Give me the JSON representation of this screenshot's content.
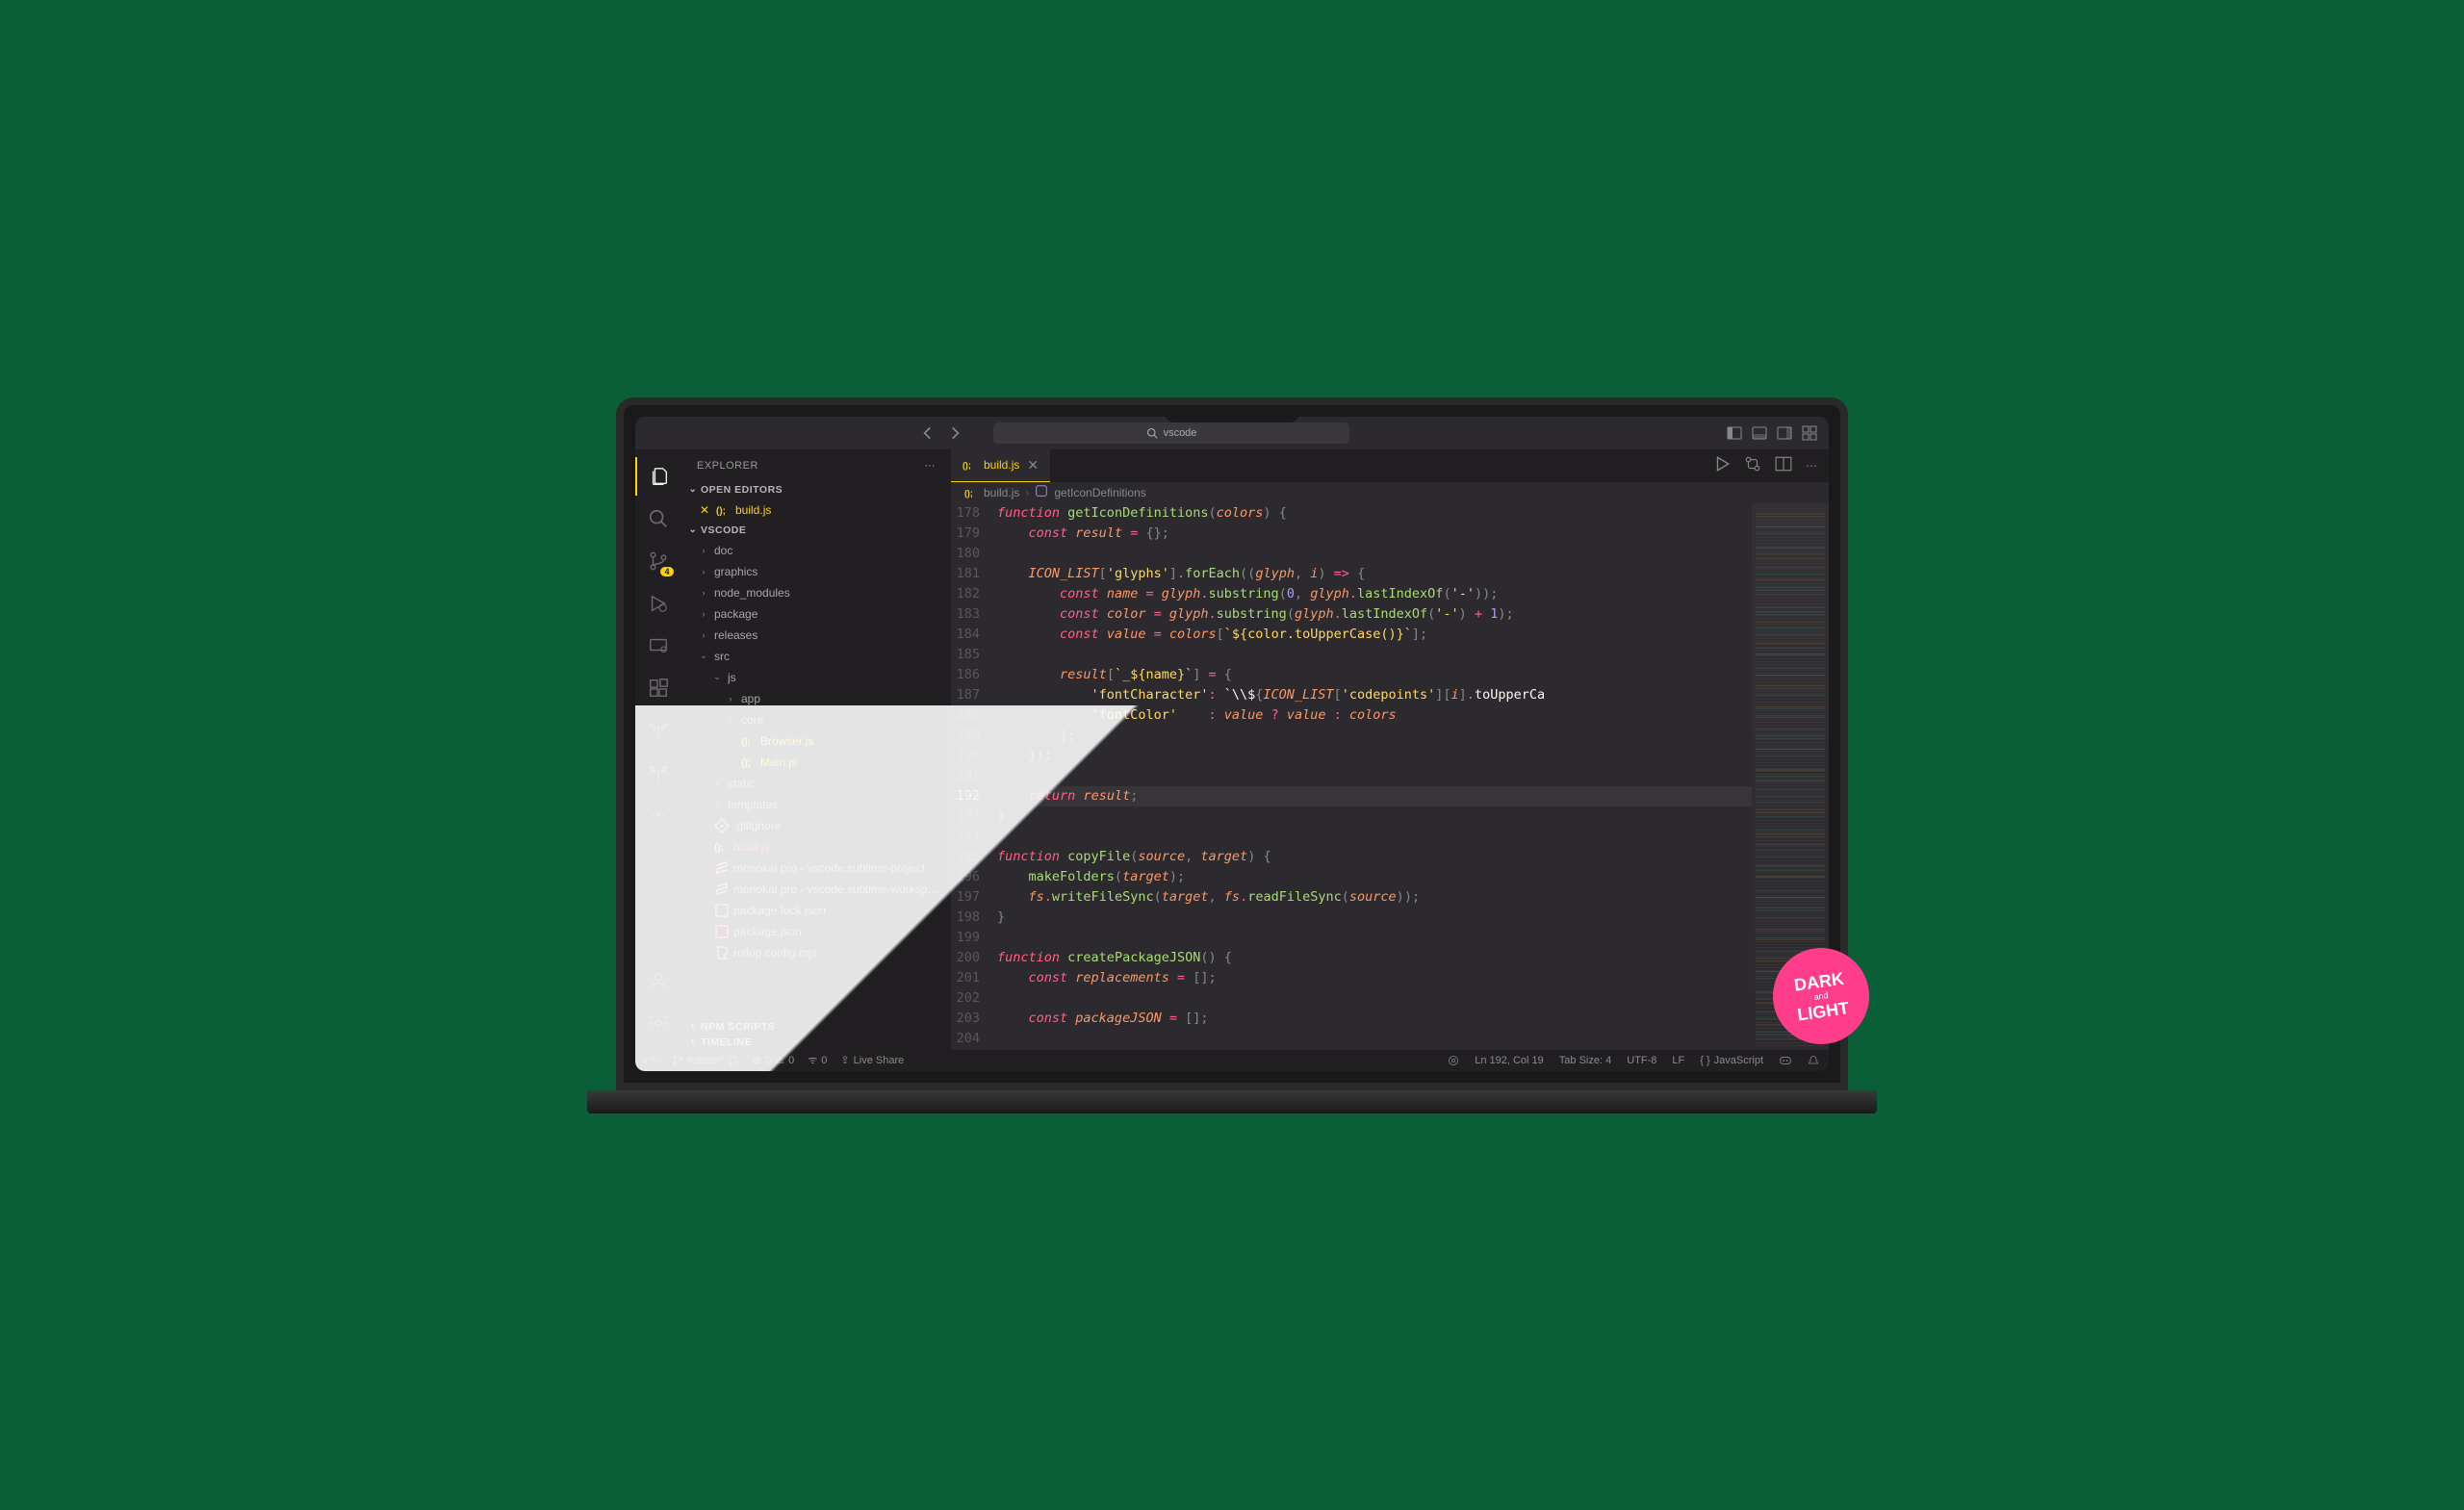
{
  "titlebar": {
    "search_placeholder": "vscode"
  },
  "sidebar": {
    "title": "EXPLORER",
    "sections": {
      "open_editors": {
        "label": "OPEN EDITORS",
        "items": [
          {
            "label": "build.js",
            "modified": true
          }
        ]
      },
      "project": {
        "label": "VSCODE",
        "tree": [
          {
            "label": "doc",
            "type": "folder",
            "depth": 0,
            "expanded": false
          },
          {
            "label": "graphics",
            "type": "folder",
            "depth": 0,
            "expanded": false
          },
          {
            "label": "node_modules",
            "type": "folder",
            "depth": 0,
            "expanded": false
          },
          {
            "label": "package",
            "type": "folder",
            "depth": 0,
            "expanded": false
          },
          {
            "label": "releases",
            "type": "folder",
            "depth": 0,
            "expanded": false
          },
          {
            "label": "src",
            "type": "folder",
            "depth": 0,
            "expanded": true
          },
          {
            "label": "js",
            "type": "folder",
            "depth": 1,
            "expanded": true
          },
          {
            "label": "app",
            "type": "folder",
            "depth": 2,
            "expanded": false
          },
          {
            "label": "core",
            "type": "folder",
            "depth": 2,
            "expanded": false
          },
          {
            "label": "Browser.js",
            "type": "js",
            "depth": 2,
            "modified": true
          },
          {
            "label": "Main.js",
            "type": "js",
            "depth": 2,
            "modified": true
          },
          {
            "label": "static",
            "type": "folder",
            "depth": 1,
            "expanded": false
          },
          {
            "label": "templates",
            "type": "folder",
            "depth": 1,
            "expanded": false
          },
          {
            "label": ".gitignore",
            "type": "git",
            "depth": 0
          },
          {
            "label": "build.js",
            "type": "js",
            "depth": 0,
            "current": true
          },
          {
            "label": "monokai pro - vscode.sublime-project",
            "type": "sublime",
            "depth": 0
          },
          {
            "label": "monokai pro - vscode.sublime-worksp…",
            "type": "sublime",
            "depth": 0
          },
          {
            "label": "package-lock.json",
            "type": "json",
            "depth": 0
          },
          {
            "label": "package.json",
            "type": "json",
            "depth": 0
          },
          {
            "label": "rollup.config.mjs",
            "type": "rollup",
            "depth": 0
          }
        ]
      },
      "npm": {
        "label": "NPM SCRIPTS"
      },
      "timeline": {
        "label": "TIMELINE"
      }
    }
  },
  "activity_badge": "4",
  "tabs": {
    "active": {
      "label": "build.js"
    }
  },
  "breadcrumb": {
    "file": "build.js",
    "symbol": "getIconDefinitions"
  },
  "editor": {
    "first_line": 178,
    "current_line": 192,
    "lines": [
      "function getIconDefinitions(colors) {",
      "    const result = {};",
      "",
      "    ICON_LIST['glyphs'].forEach((glyph, i) => {",
      "        const name = glyph.substring(0, glyph.lastIndexOf('-'));",
      "        const color = glyph.substring(glyph.lastIndexOf('-') + 1);",
      "        const value = colors[`${color.toUpperCase()}`];",
      "",
      "        result[`_${name}`] = {",
      "            'fontCharacter': `\\\\${ICON_LIST['codepoints'][i].toUpperCa",
      "            'fontColor'    : value ? value : colors",
      "        };",
      "    });",
      "",
      "    return result;",
      "}",
      "",
      "function copyFile(source, target) {",
      "    makeFolders(target);",
      "    fs.writeFileSync(target, fs.readFileSync(source));",
      "}",
      "",
      "function createPackageJSON() {",
      "    const replacements = [];",
      "",
      "    const packageJSON = [];",
      ""
    ]
  },
  "statusbar": {
    "branch": "master*",
    "errors": "0",
    "warnings": "0",
    "ports": "0",
    "liveshare": "Live Share",
    "cursor": "Ln 192, Col 19",
    "tab_size": "Tab Size: 4",
    "encoding": "UTF-8",
    "eol": "LF",
    "language": "JavaScript"
  },
  "badge": {
    "top": "DARK",
    "mid": "and",
    "bot": "LIGHT"
  }
}
